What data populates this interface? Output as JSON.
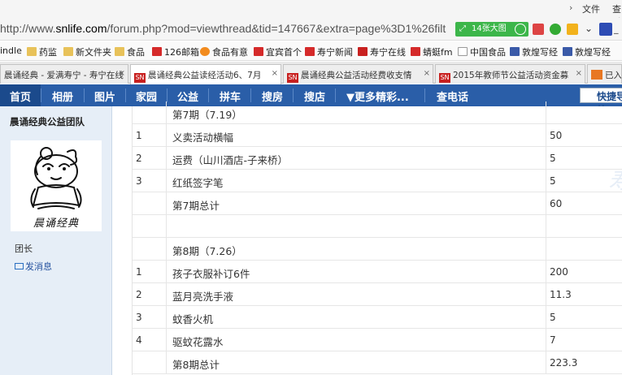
{
  "menubar": {
    "chevron": "›",
    "file": "文件",
    "view": "查看"
  },
  "address": {
    "url_prefix": "http://www.",
    "url_host": "snlife.com",
    "url_path": "/forum.php?mod=viewthread&tid=147667&extra=page%3D1%26filt",
    "bigpic_label": "14张大图"
  },
  "bookmarks": [
    {
      "label": "indle",
      "icon": "page-icon"
    },
    {
      "label": "药监",
      "icon": "folder-icon"
    },
    {
      "label": "新文件夹",
      "icon": "folder-icon"
    },
    {
      "label": "食品",
      "icon": "folder-icon"
    },
    {
      "label": "126邮箱",
      "icon": "mail-icon"
    },
    {
      "label": "食品有意",
      "icon": "smile-icon"
    },
    {
      "label": "宜宾首个",
      "icon": "flag-icon"
    },
    {
      "label": "寿宁新闻",
      "icon": "flag-icon"
    },
    {
      "label": "寿宁在线",
      "icon": "sn-icon"
    },
    {
      "label": "蜻蜓fm",
      "icon": "radio-icon"
    },
    {
      "label": "中国食品",
      "icon": "page-icon"
    },
    {
      "label": "敦煌写经",
      "icon": "book-icon"
    },
    {
      "label": "敦煌写经",
      "icon": "book-icon"
    }
  ],
  "tabs": [
    {
      "label": "晨诵经典 - 爱满寿宁 - 寿宁在线",
      "active": false
    },
    {
      "label": "晨诵经典公益读经活动6、7月",
      "active": true
    },
    {
      "label": "晨诵经典公益活动经费收支情",
      "active": false
    },
    {
      "label": "2015年教师节公益活动资金募",
      "active": false
    },
    {
      "label": "已入",
      "active": false
    }
  ],
  "nav": {
    "items": [
      "首页",
      "相册",
      "图片",
      "家园",
      "公益",
      "拼车",
      "搜房",
      "搜店",
      "▼更多精彩...",
      "查电话"
    ],
    "quick": "快捷导航"
  },
  "sidebar": {
    "team": "晨诵经典公益团队",
    "avatar_caption": "晨诵经典",
    "role": "团长",
    "message": "发消息"
  },
  "watermark": "寿宁在线",
  "table": {
    "rows": [
      {
        "no": "",
        "item": "第7期（7.19）",
        "amount": ""
      },
      {
        "no": "1",
        "item": "义卖活动横幅",
        "amount": "50"
      },
      {
        "no": "2",
        "item": "运费（山川酒店-子来桥）",
        "amount": "5"
      },
      {
        "no": "3",
        "item": "红纸签字笔",
        "amount": "5"
      },
      {
        "no": "",
        "item": "第7期总计",
        "amount": "60"
      },
      {
        "no": "",
        "item": "",
        "amount": ""
      },
      {
        "no": "",
        "item": "第8期（7.26）",
        "amount": ""
      },
      {
        "no": "1",
        "item": "孩子衣服补订6件",
        "amount": "200"
      },
      {
        "no": "2",
        "item": "蓝月亮洗手液",
        "amount": "11.3"
      },
      {
        "no": "3",
        "item": "蚊香火机",
        "amount": "5"
      },
      {
        "no": "4",
        "item": "驱蚊花露水",
        "amount": "7"
      },
      {
        "no": "",
        "item": "第8期总计",
        "amount": "223.3"
      }
    ]
  },
  "colors": {
    "nav_bg": "#2a5ea8",
    "sidebar_bg": "#e6eef7",
    "link": "#2653a0"
  }
}
